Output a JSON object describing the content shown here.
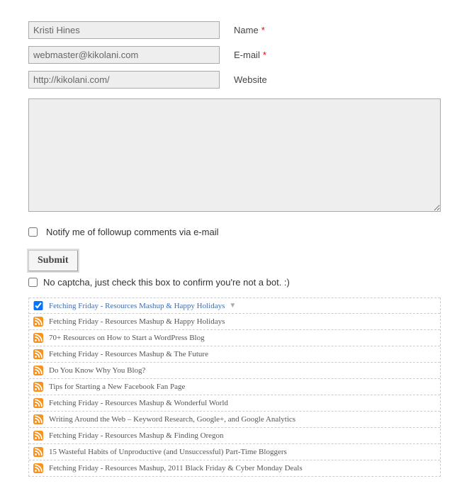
{
  "form": {
    "name": {
      "value": "Kristi Hines",
      "label": "Name",
      "required": true
    },
    "email": {
      "value": "webmaster@kikolani.com",
      "label": "E-mail",
      "required": true
    },
    "website": {
      "value": "http://kikolani.com/",
      "label": "Website",
      "required": false
    },
    "comment": {
      "value": ""
    },
    "notify": {
      "label": "Notify me of followup comments via e-mail",
      "checked": false
    },
    "submit": {
      "label": "Submit"
    },
    "captcha": {
      "label": "No captcha, just check this box to confirm you're not a bot. :)",
      "checked": false
    }
  },
  "posts": [
    {
      "title": "Fetching Friday - Resources Mashup & Happy Holidays",
      "selected": true,
      "checked": true
    },
    {
      "title": "Fetching Friday - Resources Mashup & Happy Holidays"
    },
    {
      "title": "70+ Resources on How to Start a WordPress Blog"
    },
    {
      "title": "Fetching Friday - Resources Mashup & The Future"
    },
    {
      "title": "Do You Know Why You Blog?"
    },
    {
      "title": "Tips for Starting a New Facebook Fan Page"
    },
    {
      "title": "Fetching Friday - Resources Mashup & Wonderful World"
    },
    {
      "title": "Writing Around the Web – Keyword Research, Google+, and Google Analytics"
    },
    {
      "title": "Fetching Friday - Resources Mashup & Finding Oregon"
    },
    {
      "title": "15 Wasteful Habits of Unproductive (and Unsuccessful) Part-Time Bloggers"
    },
    {
      "title": "Fetching Friday - Resources Mashup, 2011 Black Friday & Cyber Monday Deals"
    }
  ]
}
